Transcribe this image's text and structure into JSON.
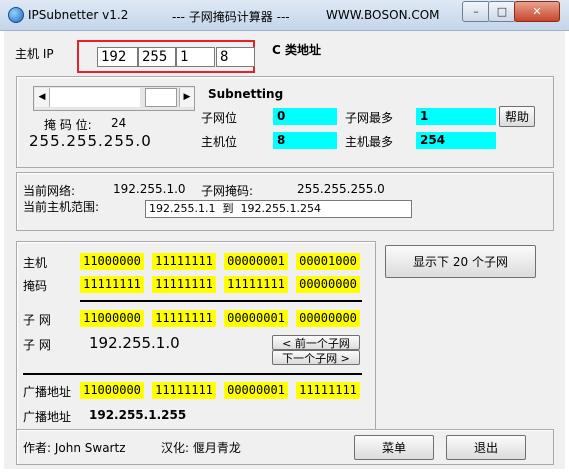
{
  "title": {
    "app": "IPSubnetter v1.2",
    "subtitle": "--- 子网掩码计算器 ---",
    "site": "WWW.BOSON.COM"
  },
  "window_controls": {
    "minimize": "–",
    "maximize": "□",
    "close": "✕"
  },
  "ip": {
    "label": "主机 IP",
    "octets": [
      "192",
      "255",
      "1",
      "8"
    ],
    "class_text": "C 类地址"
  },
  "subnetting": {
    "title": "Subnetting",
    "mask_bits_label": "掩 码 位:",
    "mask_bits_value": "24",
    "mask": "255.255.255.0",
    "subnet_bits_label": "子网位",
    "subnet_bits_value": "0",
    "host_bits_label": "主机位",
    "host_bits_value": "8",
    "max_subnets_label": "子网最多",
    "max_subnets_value": "1",
    "max_hosts_label": "主机最多",
    "max_hosts_value": "254",
    "help_button": "帮助"
  },
  "network": {
    "current_network_label": "当前网络:",
    "current_network_value": "192.255.1.0",
    "subnet_mask_label": "子网掩码:",
    "subnet_mask_value": "255.255.255.0",
    "host_range_label": "当前主机范围:",
    "host_range_value": "192.255.1.1  到  192.255.1.254"
  },
  "binary": {
    "host_label": "主机",
    "host": [
      "11000000",
      "11111111",
      "00000001",
      "00001000"
    ],
    "mask_label": "掩码",
    "mask": [
      "11111111",
      "11111111",
      "11111111",
      "00000000"
    ],
    "subnet_label": "子 网",
    "subnet": [
      "11000000",
      "11111111",
      "00000001",
      "00000000"
    ],
    "subnet_dotted_label": "子 网",
    "subnet_dotted": "192.255.1.0",
    "prev_button": "< 前一个子网",
    "next_button": "下一个子网 >",
    "broadcast_label": "广播地址",
    "broadcast": [
      "11000000",
      "11111111",
      "00000001",
      "11111111"
    ],
    "broadcast_dotted_label": "广播地址",
    "broadcast_dotted": "192.255.1.255"
  },
  "show_subnets_button": "显示下 20 个子网",
  "footer": {
    "author": "作者: John Swartz",
    "localized": "汉化: 偃月青龙",
    "menu_button": "菜单",
    "exit_button": "退出"
  }
}
